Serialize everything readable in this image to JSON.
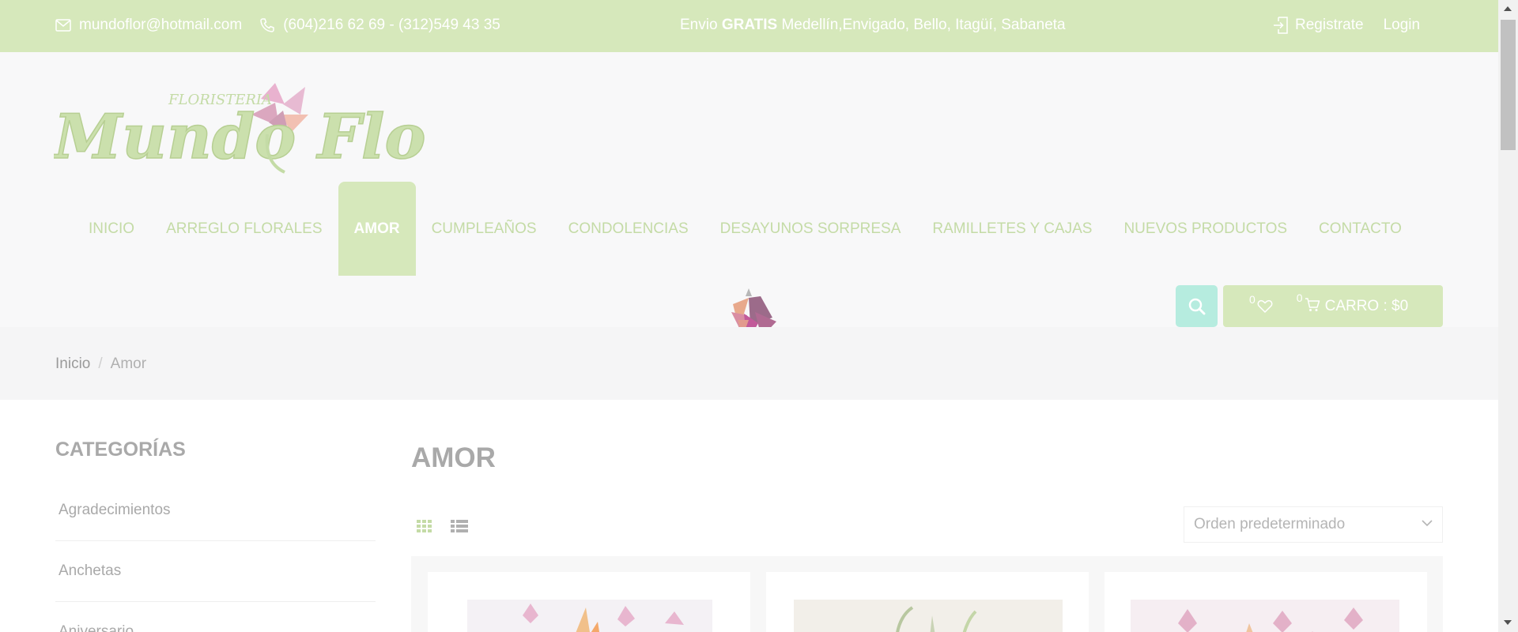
{
  "topbar": {
    "email": "mundoflor@hotmail.com",
    "phone": "(604)216 62 69 - (312)549 43 35",
    "promo_prefix": "Envio ",
    "promo_bold": "GRATIS",
    "promo_suffix": " Medellín,Envigado, Bello, Itagüí, Sabaneta",
    "register": "Registrate",
    "login": "Login",
    "email_icon": "mail-icon",
    "phone_icon": "phone-icon",
    "register_icon": "sign-in-icon"
  },
  "logo": {
    "small_text": "FLORISTERIA",
    "main_text": "Mundo Flor"
  },
  "nav": {
    "items": [
      {
        "label": "INICIO"
      },
      {
        "label": "ARREGLO FLORALES"
      },
      {
        "label": "AMOR",
        "active": true
      },
      {
        "label": "CUMPLEAÑOS"
      },
      {
        "label": "CONDOLENCIAS"
      },
      {
        "label": "DESAYUNOS SORPRESA"
      },
      {
        "label": "RAMILLETES Y CAJAS"
      },
      {
        "label": "NUEVOS PRODUCTOS"
      },
      {
        "label": "CONTACTO"
      }
    ]
  },
  "header_actions": {
    "search_icon": "search-icon",
    "wishlist_count": "0",
    "wishlist_icon": "heart-icon",
    "cart_count": "0",
    "cart_icon": "cart-icon",
    "cart_label": "CARRO : $0"
  },
  "breadcrumb": {
    "home": "Inicio",
    "separator": "/",
    "current": "Amor"
  },
  "sidebar": {
    "title": "CATEGORÍAS",
    "categories": [
      {
        "label": "Agradecimientos"
      },
      {
        "label": "Anchetas"
      },
      {
        "label": "Aniversario"
      }
    ]
  },
  "main": {
    "title": "AMOR",
    "sort_selected": "Orden predeterminado",
    "grid_icon": "grid-view-icon",
    "list_icon": "list-view-icon"
  },
  "colors": {
    "accent": "#d6e8bb",
    "nav_text": "#c4dba6",
    "search_bg": "#b6ecdf"
  }
}
